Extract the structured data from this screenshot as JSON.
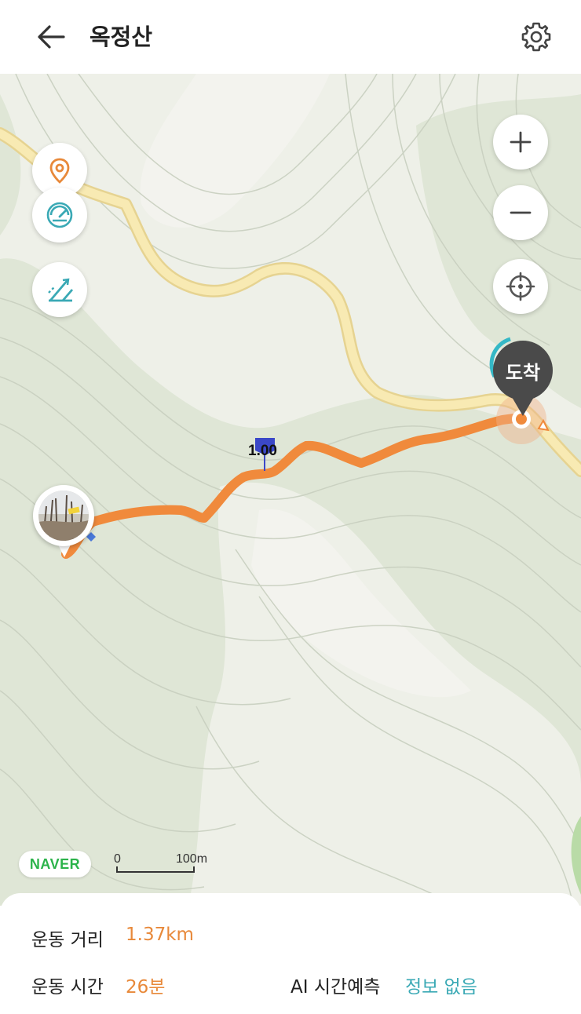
{
  "header": {
    "title": "옥정산"
  },
  "map": {
    "arrival_label": "도착",
    "km_marker": "1.00",
    "naver_logo": "NAVER",
    "scale": {
      "start_label": "0",
      "end_label": "100m"
    }
  },
  "stats": {
    "distance_label": "운동 거리",
    "distance_value": "1.37km",
    "time_label": "운동 시간",
    "time_value": "26분",
    "ai_label": "AI 시간예측",
    "ai_value": "정보 없음"
  },
  "colors": {
    "route": "#f08a3c",
    "accent_orange": "#e8893a",
    "accent_teal": "#3aa9b5",
    "road": "#f7e7a6",
    "forest": "#dfe6d6",
    "land": "#eef0e8"
  },
  "icons": {
    "back": "arrow-left-icon",
    "settings": "gear-icon",
    "poi": "location-pin-icon",
    "speed": "speedometer-icon",
    "slope": "slope-icon",
    "zoom_in": "plus-icon",
    "zoom_out": "minus-icon",
    "locate": "crosshair-icon"
  }
}
